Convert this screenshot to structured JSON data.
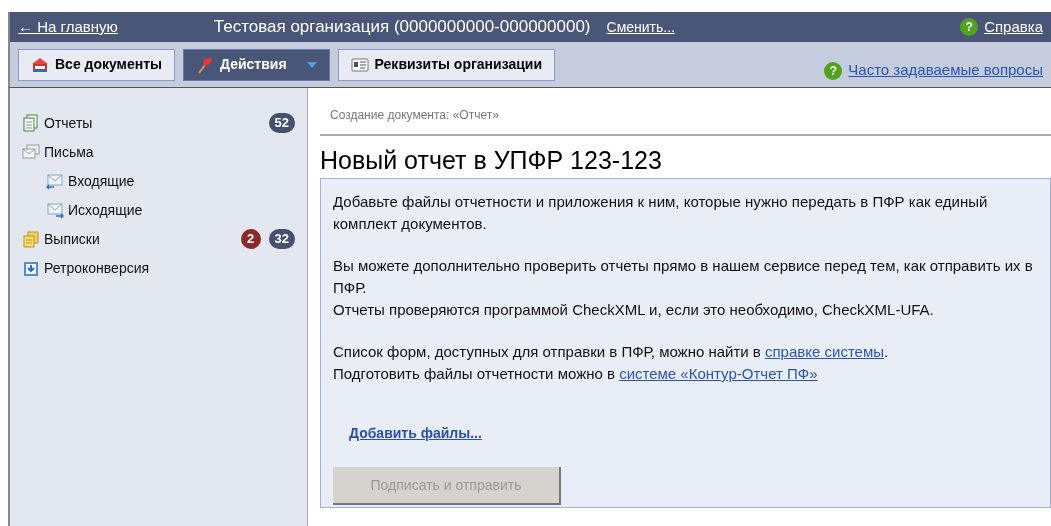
{
  "header": {
    "home_link": "← На главную",
    "organization": "Тестовая организация (0000000000-000000000)",
    "change_link": "Сменить...",
    "help_link": "Справка",
    "help_icon": "?"
  },
  "toolbar": {
    "buttons": [
      {
        "label": "Все документы",
        "kind": "docs",
        "selected": false
      },
      {
        "label": "Действия",
        "kind": "actions",
        "selected": true
      },
      {
        "label": "Реквизиты организации",
        "kind": "card",
        "selected": false
      }
    ],
    "faq_link": "Часто задаваемые вопросы",
    "faq_icon": "?"
  },
  "sidebar": {
    "items": [
      {
        "label": "Отчеты",
        "kind": "reports",
        "badges": [
          {
            "text": "52",
            "color": "#46506f"
          }
        ]
      },
      {
        "label": "Письма",
        "kind": "letters",
        "children": [
          {
            "label": "Входящие",
            "kind": "inbox"
          },
          {
            "label": "Исходящие",
            "kind": "outbox"
          }
        ]
      },
      {
        "label": "Выписки",
        "kind": "statements",
        "badges": [
          {
            "text": "2",
            "color": "#8b2b2b"
          },
          {
            "text": "32",
            "color": "#46506f"
          }
        ]
      },
      {
        "label": "Ретроконверсия",
        "kind": "retro"
      }
    ]
  },
  "breadcrumb": "Создание документа: «Отчет»",
  "title": "Новый отчет в УПФР 123-123",
  "info": {
    "groups": [
      [
        [
          {
            "kind": "text",
            "text": "Добавьте файлы отчетности и приложения к ним, которые нужно передать в ПФР как единый комплект документов."
          }
        ]
      ],
      [
        [
          {
            "kind": "text",
            "text": "Вы можете дополнительно проверить отчеты прямо в нашем сервисе перед тем, как отправить их в ПФР."
          }
        ],
        [
          {
            "kind": "text",
            "text": "Отчеты проверяются программой CheckXML и, если это необходимо, CheckXML-UFA."
          }
        ]
      ],
      [
        [
          {
            "kind": "text",
            "text": "Список форм, доступных для отправки в ПФР, можно найти в "
          },
          {
            "kind": "link",
            "text": "справке системы"
          },
          {
            "kind": "text",
            "text": "."
          }
        ],
        [
          {
            "kind": "text",
            "text": "Подготовить файлы отчетности можно в "
          },
          {
            "kind": "link",
            "text": "системе «Контур-Отчет ПФ»"
          }
        ]
      ]
    ],
    "add_files_link": "Добавить файлы...",
    "submit": {
      "label": "Подписать и отправить",
      "disabled": true
    }
  }
}
